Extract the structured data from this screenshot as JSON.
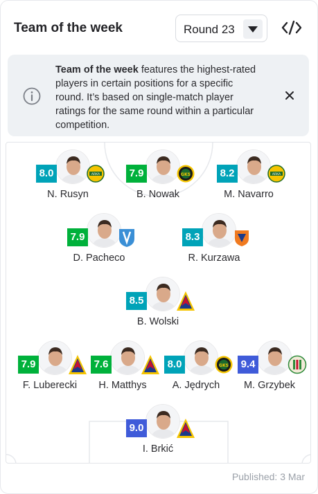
{
  "header": {
    "title": "Team of the week",
    "round_value": "Round 23"
  },
  "info": {
    "bold": "Team of the week",
    "text": " features the highest-rated players in certain positions for a specific round. It’s based on single-match player ratings for the same round within a particular competition."
  },
  "players": [
    {
      "name": "N. Rusyn",
      "rating": "8.0",
      "rating_color": "#00a3b8",
      "club": "Arka",
      "club_color": "#f5c400"
    },
    {
      "name": "B. Nowak",
      "rating": "7.9",
      "rating_color": "#00b13b",
      "club": "GKS Katowice",
      "club_color": "#1a6b2e"
    },
    {
      "name": "M. Navarro",
      "rating": "8.2",
      "rating_color": "#00a3b8",
      "club": "Arka",
      "club_color": "#f5c400"
    },
    {
      "name": "D. Pacheco",
      "rating": "7.9",
      "rating_color": "#00b13b",
      "club": "Wisła Płock",
      "club_color": "#3a8fd6"
    },
    {
      "name": "R. Kurzawa",
      "rating": "8.3",
      "rating_color": "#00a3b8",
      "club": "Termalica",
      "club_color": "#f07a20"
    },
    {
      "name": "B. Wolski",
      "rating": "8.5",
      "rating_color": "#00a3b8",
      "club": "Pogoń Szczecin",
      "club_color": "#1b3a8a"
    },
    {
      "name": "F. Luberecki",
      "rating": "7.9",
      "rating_color": "#00b13b",
      "club": "Pogoń Szczecin",
      "club_color": "#1b3a8a"
    },
    {
      "name": "H. Matthys",
      "rating": "7.6",
      "rating_color": "#00b13b",
      "club": "Pogoń Szczecin",
      "club_color": "#1b3a8a"
    },
    {
      "name": "A. Jędrych",
      "rating": "8.0",
      "rating_color": "#00a3b8",
      "club": "GKS Katowice",
      "club_color": "#1a6b2e"
    },
    {
      "name": "M. Grzybek",
      "rating": "9.4",
      "rating_color": "#3f5bd9",
      "club": "Zagłębie",
      "club_color": "#2e8b3a"
    },
    {
      "name": "I. Brkić",
      "rating": "9.0",
      "rating_color": "#3f5bd9",
      "club": "Pogoń Szczecin",
      "club_color": "#1b3a8a"
    }
  ],
  "footer": {
    "published": "Published: 3 Mar"
  }
}
